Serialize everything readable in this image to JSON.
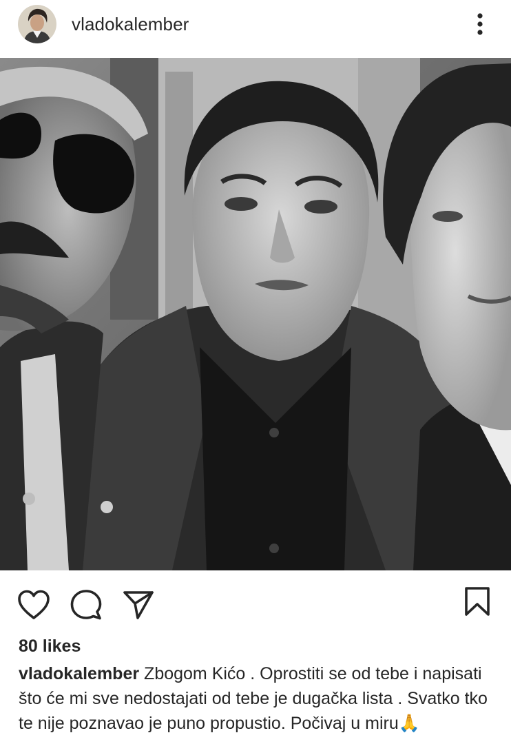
{
  "post": {
    "username": "vladokalember",
    "likes_label": "80 likes",
    "caption_username": "vladokalember",
    "caption_text": "Zbogom Kićo . Oprostiti se od tebe i napisati što će mi sve nedostajati od tebe je dugačka lista . Svatko tko te nije poznavao je puno propustio. Počivaj u miru🙏"
  },
  "icons": {
    "more": "more-vertical-icon",
    "like": "heart-icon",
    "comment": "comment-icon",
    "share": "send-icon",
    "save": "bookmark-icon"
  },
  "colors": {
    "text": "#262626",
    "background": "#ffffff"
  }
}
